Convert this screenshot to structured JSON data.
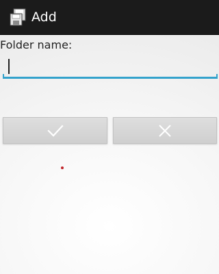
{
  "window": {
    "title": "Add",
    "app_icon": "floppy-disk-icon"
  },
  "form": {
    "field_label": "Folder name:",
    "folder_name_value": "",
    "folder_name_placeholder": ""
  },
  "actions": {
    "confirm_icon": "checkmark-icon",
    "cancel_icon": "close-icon"
  },
  "colors": {
    "titlebar": "#1b1b1b",
    "title_text": "#ffffff",
    "input_accent": "#33a2cc",
    "button_face": "#d6d6d6",
    "button_icon": "#ffffff"
  }
}
